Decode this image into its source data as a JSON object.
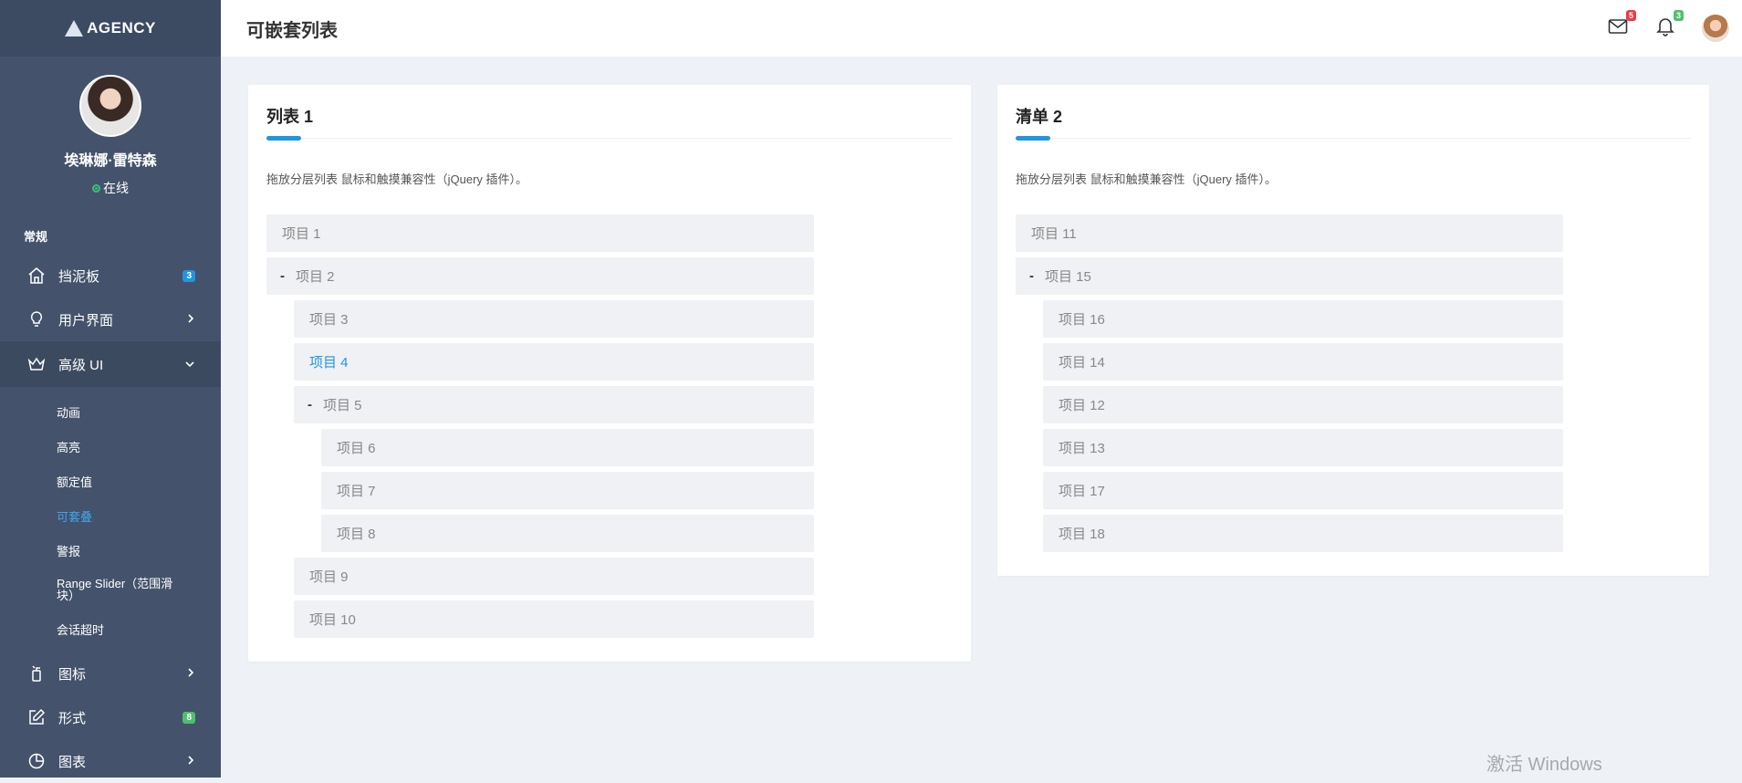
{
  "brand": {
    "name": "AGENCY"
  },
  "user": {
    "name": "埃琳娜·雷特森",
    "status": "在线"
  },
  "sidebar": {
    "section_label": "常规",
    "items": [
      {
        "label": "挡泥板",
        "badge": "3"
      },
      {
        "label": "用户界面"
      },
      {
        "label": "高级 UI"
      },
      {
        "label": "图标"
      },
      {
        "label": "形式",
        "badge": "8"
      },
      {
        "label": "图表"
      }
    ],
    "subitems": [
      "动画",
      "高亮",
      "额定值",
      "可套叠",
      "警报",
      "Range Slider（范围滑块）",
      "会话超时"
    ]
  },
  "header": {
    "title": "可嵌套列表",
    "mail_badge": "5",
    "bell_badge": "3"
  },
  "list1": {
    "title": "列表 1",
    "description": "拖放分层列表 鼠标和触摸兼容性（jQuery 插件）。",
    "items": [
      "项目 1",
      "项目 2",
      "项目 3",
      "项目 4",
      "项目 5",
      "项目 6",
      "项目 7",
      "项目 8",
      "项目 9",
      "项目 10"
    ]
  },
  "list2": {
    "title": "清单 2",
    "description": "拖放分层列表 鼠标和触摸兼容性（jQuery 插件）。",
    "items": [
      "项目 11",
      "项目 15",
      "项目 16",
      "项目 14",
      "项目 12",
      "项目 13",
      "项目 17",
      "项目 18"
    ]
  },
  "collapse_symbol": "-",
  "watermark": "激活 Windows",
  "colors": {
    "sidebar": "#44536b",
    "accent": "#2196de",
    "badge_red": "#e83b4d",
    "badge_green": "#4fbf6e"
  }
}
